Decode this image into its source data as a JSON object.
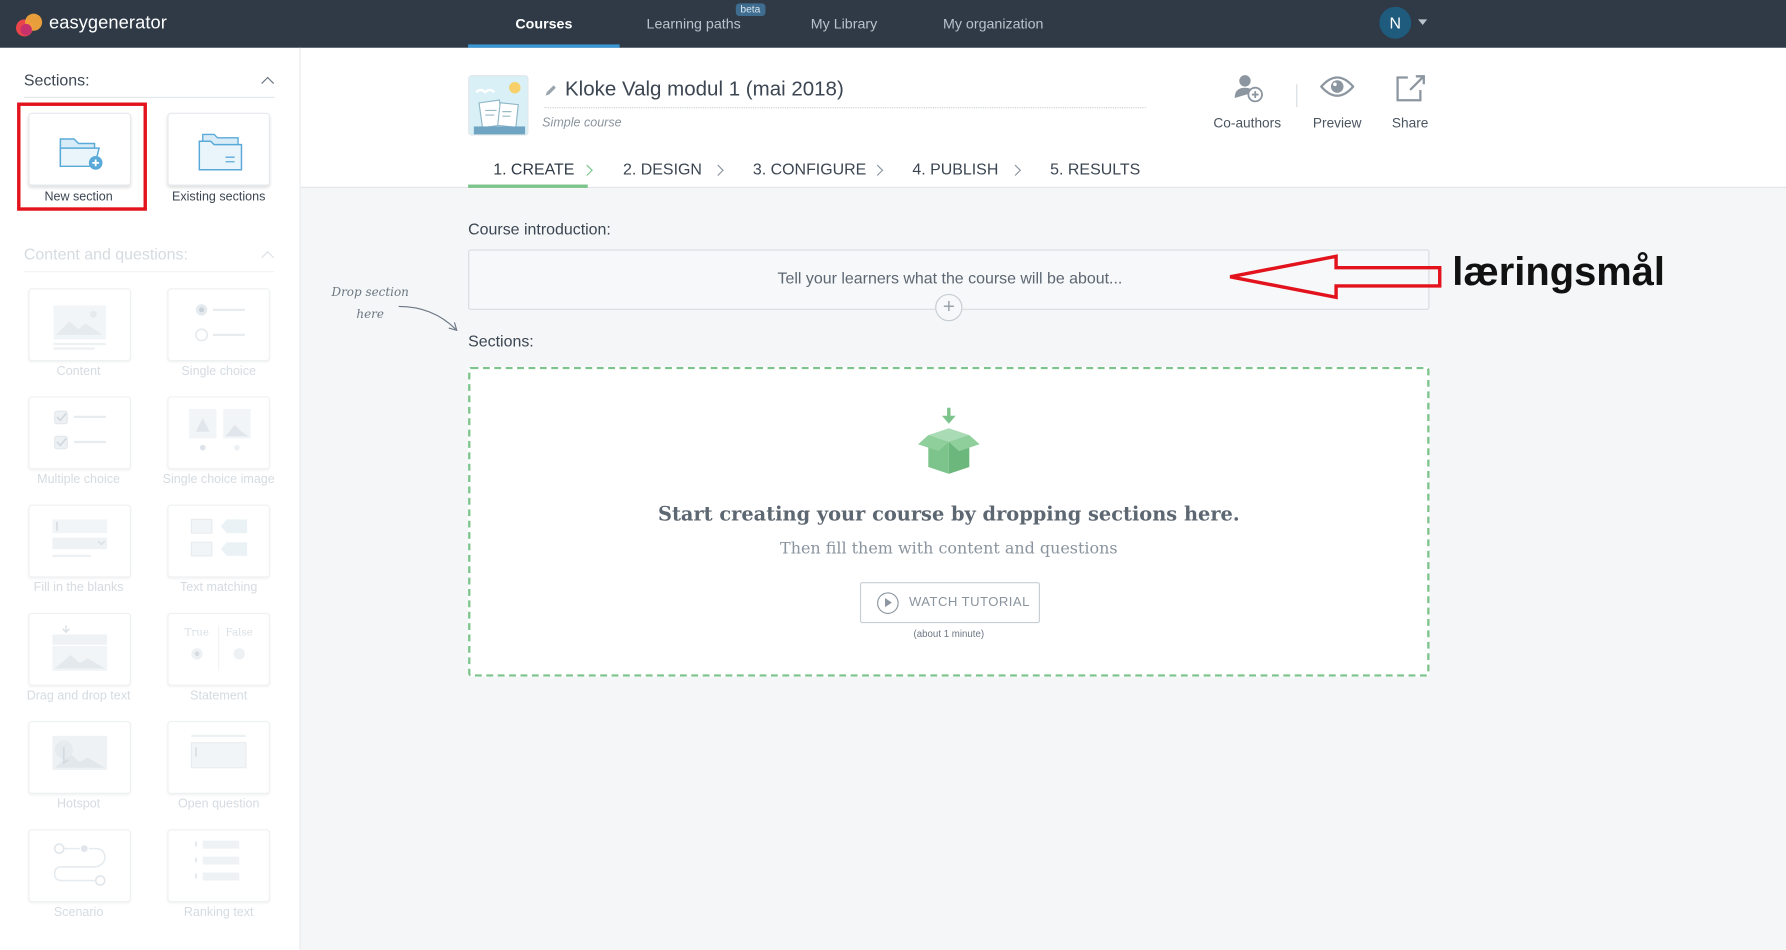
{
  "app": {
    "brand": "easygenerator",
    "accent": "#3a97d4",
    "success": "#7cc48b",
    "annotation_color": "#e3131d"
  },
  "nav": {
    "items": [
      {
        "label": "Courses",
        "active": true
      },
      {
        "label": "Learning paths",
        "badge": "beta"
      },
      {
        "label": "My Library"
      },
      {
        "label": "My organization"
      }
    ],
    "avatar_initial": "N"
  },
  "sidebar": {
    "sections_heading": "Sections:",
    "section_tiles": [
      {
        "label": "New section",
        "icon": "folder-add-icon",
        "highlighted": true
      },
      {
        "label": "Existing sections",
        "icon": "folders-icon"
      }
    ],
    "content_heading": "Content and questions:",
    "content_tiles": [
      {
        "label": "Content",
        "icon": "content-icon"
      },
      {
        "label": "Single choice",
        "icon": "single-choice-icon"
      },
      {
        "label": "Multiple choice",
        "icon": "multiple-choice-icon"
      },
      {
        "label": "Single choice image",
        "icon": "single-choice-image-icon"
      },
      {
        "label": "Fill in the blanks",
        "icon": "fill-blanks-icon"
      },
      {
        "label": "Text matching",
        "icon": "text-matching-icon"
      },
      {
        "label": "Drag and drop text",
        "icon": "drag-drop-icon"
      },
      {
        "label": "Statement",
        "icon": "statement-icon"
      },
      {
        "label": "Hotspot",
        "icon": "hotspot-icon"
      },
      {
        "label": "Open question",
        "icon": "open-question-icon"
      },
      {
        "label": "Scenario",
        "icon": "scenario-icon"
      },
      {
        "label": "Ranking text",
        "icon": "ranking-icon"
      }
    ],
    "statement_true": "True",
    "statement_false": "False"
  },
  "course": {
    "title": "Kloke Valg modul 1 (mai 2018)",
    "type": "Simple course",
    "actions": [
      {
        "label": "Co-authors",
        "icon": "co-authors-icon"
      },
      {
        "label": "Preview",
        "icon": "eye-icon"
      },
      {
        "label": "Share",
        "icon": "share-icon"
      }
    ]
  },
  "steps": [
    {
      "label": "1. CREATE",
      "active": true
    },
    {
      "label": "2. DESIGN"
    },
    {
      "label": "3. CONFIGURE"
    },
    {
      "label": "4. PUBLISH"
    },
    {
      "label": "5. RESULTS"
    }
  ],
  "main": {
    "intro_label": "Course introduction:",
    "intro_placeholder": "Tell your learners what the course will be about...",
    "sections_label": "Sections:",
    "drop_hint": "Drop section here",
    "dropzone": {
      "title": "Start creating your course by dropping sections here.",
      "subtitle": "Then fill them with content and questions",
      "tutorial_label": "WATCH TUTORIAL",
      "tutorial_note": "(about 1 minute)"
    }
  },
  "annotation": {
    "text": "læringsmål"
  }
}
